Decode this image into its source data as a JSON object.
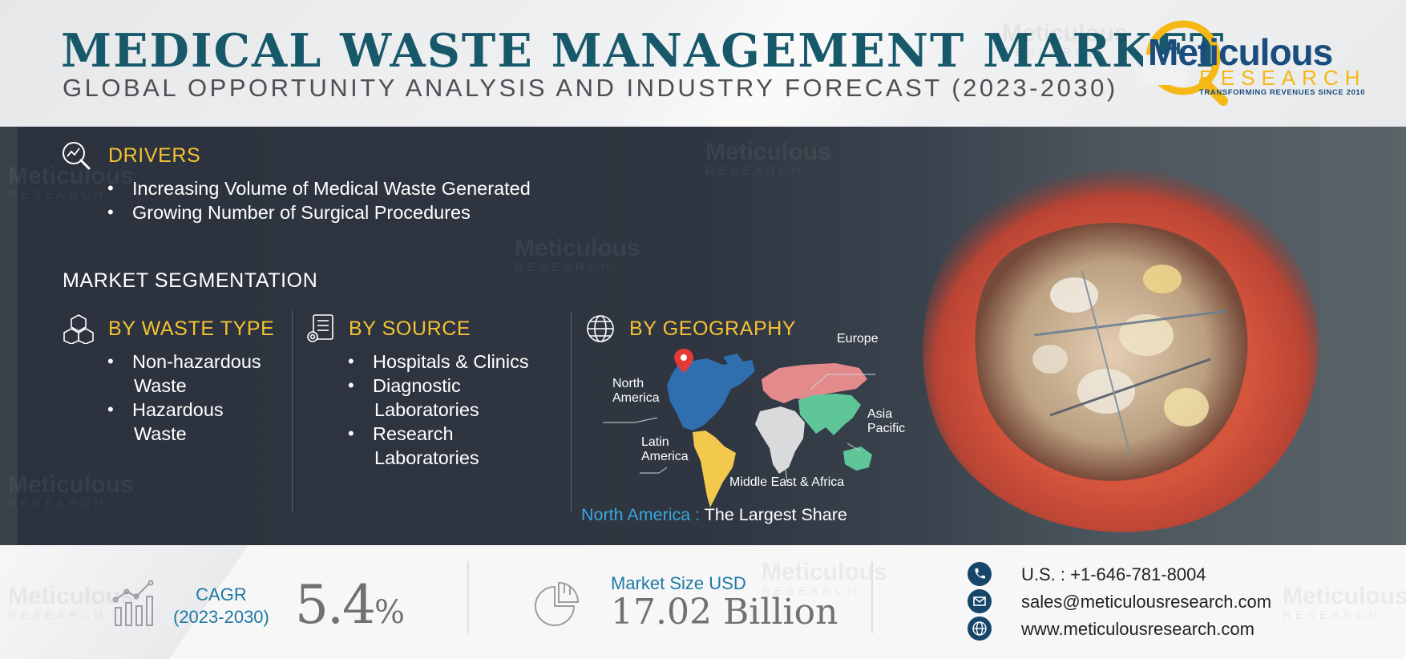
{
  "header": {
    "title": "MEDICAL WASTE MANAGEMENT MARKET",
    "subtitle": "GLOBAL OPPORTUNITY ANALYSIS AND INDUSTRY FORECAST (2023-2030)"
  },
  "logo": {
    "brand": "Meticulous",
    "sub": "RESEARCH",
    "tagline": "TRANSFORMING REVENUES SINCE 2010",
    "watermark_brand": "Meticulous",
    "watermark_sub": "RESEARCH"
  },
  "drivers": {
    "heading": "DRIVERS",
    "items": [
      "Increasing Volume of Medical Waste Generated",
      "Growing Number of Surgical Procedures"
    ]
  },
  "segmentation": {
    "heading": "MARKET SEGMENTATION",
    "waste_type": {
      "heading": "BY WASTE TYPE",
      "items": [
        [
          "Non-hazardous",
          "Waste"
        ],
        [
          "Hazardous",
          "Waste"
        ]
      ]
    },
    "source": {
      "heading": "BY SOURCE",
      "items": [
        [
          "Hospitals & Clinics"
        ],
        [
          "Diagnostic",
          "Laboratories"
        ],
        [
          "Research",
          "Laboratories"
        ]
      ]
    },
    "geography": {
      "heading": "BY GEOGRAPHY",
      "regions": {
        "europe": "Europe",
        "north_america": [
          "North",
          "America"
        ],
        "asia_pacific": [
          "Asia",
          "Pacific"
        ],
        "latin_america": [
          "Latin",
          "America"
        ],
        "mea": "Middle East & Africa"
      },
      "largest_region": "North America :",
      "largest_text": " The Largest Share"
    }
  },
  "stats": {
    "cagr_label_1": "CAGR",
    "cagr_label_2": "(2023-2030)",
    "cagr_value": "5.4",
    "cagr_unit": "%",
    "market_size_label": "Market Size USD",
    "market_size_value": "17.02 Billion"
  },
  "contact": {
    "phone": "U.S. : +1-646-781-8004",
    "email": "sales@meticulousresearch.com",
    "website": "www.meticulousresearch.com"
  },
  "colors": {
    "title": "#17596a",
    "accent_yellow": "#f4c233",
    "accent_blue": "#1e78a4",
    "brand_navy": "#1a4d7e",
    "north_america": "#2f6fb0",
    "europe": "#e38b8b",
    "asia_pacific": "#5fc69a",
    "latin_america": "#f2c94c",
    "africa": "#d9dadc"
  }
}
